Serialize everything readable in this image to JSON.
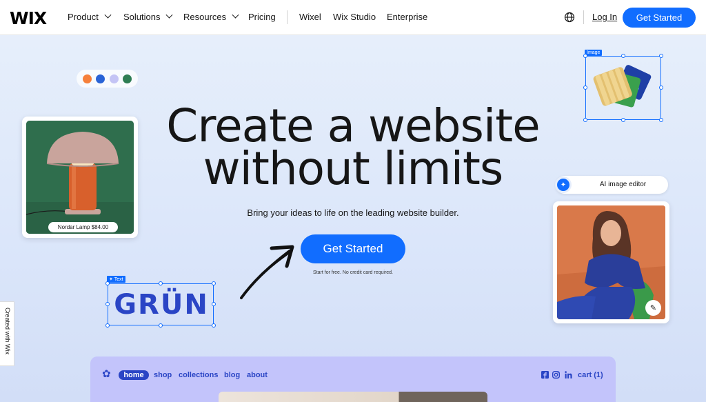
{
  "header": {
    "logo": "WIX",
    "nav": [
      "Product",
      "Solutions",
      "Resources",
      "Pricing",
      "Wixel",
      "Wix Studio",
      "Enterprise"
    ],
    "login": "Log In",
    "cta": "Get Started",
    "globe_icon": "globe-icon"
  },
  "hero": {
    "headline_line1": "Create a website",
    "headline_line2": "without limits",
    "subline": "Bring your ideas to life on the leading website builder.",
    "cta": "Get Started",
    "note": "Start for free. No credit card required."
  },
  "decor": {
    "palette": [
      "#f6803b",
      "#2963d6",
      "#c4c4f5",
      "#2e7d53"
    ],
    "lamp_tag": "Nordar Lamp $84.00",
    "image_label": "Image",
    "text_label": "Text",
    "text_element": "GRÜN",
    "ai_editor": "AI image editor"
  },
  "side_tab": "Created with Wix",
  "preview": {
    "nav": [
      "home",
      "shop",
      "collections",
      "blog",
      "about"
    ],
    "cart": "cart (1)",
    "social_icons": [
      "facebook-icon",
      "instagram-icon",
      "linkedin-icon"
    ]
  },
  "colors": {
    "accent": "#116dff",
    "preview_bg": "#c3c4fb",
    "preview_text": "#2a45c5"
  }
}
